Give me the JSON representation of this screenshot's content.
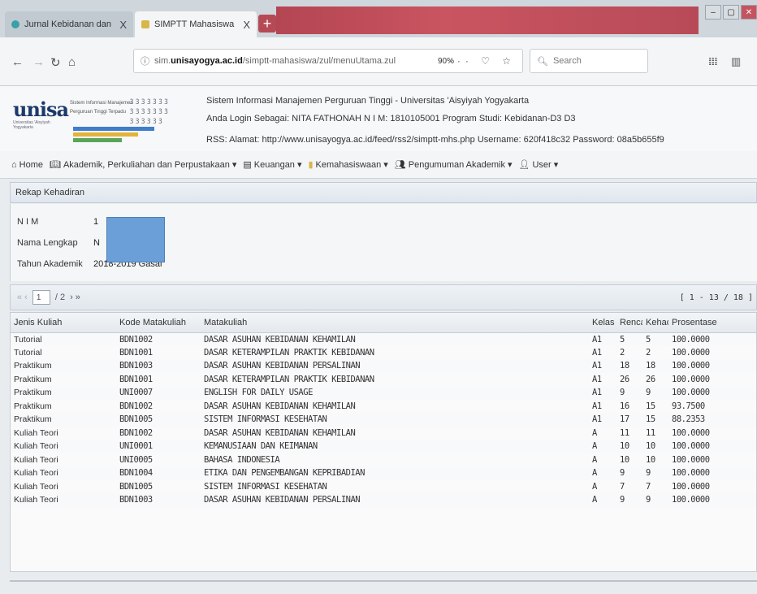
{
  "browser": {
    "tabs": [
      {
        "title": "Jurnal Kebidanan dan Kepera",
        "close": "X"
      },
      {
        "title": "SIMPTT Mahasiswa",
        "close": "X"
      }
    ],
    "new_tab": "+",
    "url_prefix": "sim.",
    "url_host": "unisayogya.ac.id",
    "url_path": "/simptt-mahasiswa/zul/menuUtama.zul",
    "zoom": "90%",
    "search_placeholder": "Search",
    "url_actions": "··· ♡ ☆"
  },
  "header": {
    "logo_text": "unisa",
    "logo_sub": "Universitas 'Aisyiyah Yogyakarta",
    "sim_line1": "Sistem Informasi Manajemen",
    "sim_line2": "Perguruan Tinggi Terpadu",
    "title": "Sistem Informasi Manajemen Perguruan Tinggi - Universitas 'Aisyiyah Yogyakarta",
    "login_line": "Anda Login Sebagai: NITA FATHONAH   N I M: 1810105001   Program Studi: Kebidanan-D3 D3",
    "rss_line": "RSS:   Alamat: http://www.unisayogya.ac.id/feed/rss2/simptt-mhs.php    Username: 620f418c32    Password: 08a5b655f9"
  },
  "menu": [
    "Home",
    "Akademik, Perkuliahan dan Perpustakaan",
    "Keuangan",
    "Kemahasiswaan",
    "Pengumuman Akademik",
    "User"
  ],
  "panel": {
    "title": "Rekap Kehadiran",
    "nim_label": "N I M",
    "nim_value": "1",
    "nama_label": "Nama Lengkap",
    "nama_value": "N",
    "tahun_label": "Tahun Akademik",
    "tahun_value": "2018-2019 Gasal"
  },
  "pager": {
    "first": "« ‹",
    "page": "1",
    "total": "/ 2",
    "next": "› »",
    "range": "[ 1 - 13 / 18 ]"
  },
  "table": {
    "headers": [
      "Jenis Kuliah",
      "Kode Matakuliah",
      "Matakuliah",
      "Kelas",
      "Rencana",
      "Kehadiran",
      "Prosentase"
    ],
    "rows": [
      [
        "Tutorial",
        "BDN1002",
        "DASAR ASUHAN KEBIDANAN KEHAMILAN",
        "A1",
        "5",
        "5",
        "100.0000"
      ],
      [
        "Tutorial",
        "BDN1001",
        "DASAR KETERAMPILAN PRAKTIK KEBIDANAN",
        "A1",
        "2",
        "2",
        "100.0000"
      ],
      [
        "Praktikum",
        "BDN1003",
        "DASAR ASUHAN KEBIDANAN PERSALINAN",
        "A1",
        "18",
        "18",
        "100.0000"
      ],
      [
        "Praktikum",
        "BDN1001",
        "DASAR KETERAMPILAN PRAKTIK KEBIDANAN",
        "A1",
        "26",
        "26",
        "100.0000"
      ],
      [
        "Praktikum",
        "UNI0007",
        "ENGLISH FOR DAILY USAGE",
        "A1",
        "9",
        "9",
        "100.0000"
      ],
      [
        "Praktikum",
        "BDN1002",
        "DASAR ASUHAN KEBIDANAN KEHAMILAN",
        "A1",
        "16",
        "15",
        "93.7500"
      ],
      [
        "Praktikum",
        "BDN1005",
        "SISTEM INFORMASI KESEHATAN",
        "A1",
        "17",
        "15",
        "88.2353"
      ],
      [
        "Kuliah Teori",
        "BDN1002",
        "DASAR ASUHAN KEBIDANAN KEHAMILAN",
        "A",
        "11",
        "11",
        "100.0000"
      ],
      [
        "Kuliah Teori",
        "UNI0001",
        "KEMANUSIAAN DAN KEIMANAN",
        "A",
        "10",
        "10",
        "100.0000"
      ],
      [
        "Kuliah Teori",
        "UNI0005",
        "BAHASA INDONESIA",
        "A",
        "10",
        "10",
        "100.0000"
      ],
      [
        "Kuliah Teori",
        "BDN1004",
        "ETIKA DAN PENGEMBANGAN KEPRIBADIAN",
        "A",
        "9",
        "9",
        "100.0000"
      ],
      [
        "Kuliah Teori",
        "BDN1005",
        "SISTEM INFORMASI KESEHATAN",
        "A",
        "7",
        "7",
        "100.0000"
      ],
      [
        "Kuliah Teori",
        "BDN1003",
        "DASAR ASUHAN KEBIDANAN PERSALINAN",
        "A",
        "9",
        "9",
        "100.0000"
      ]
    ]
  }
}
